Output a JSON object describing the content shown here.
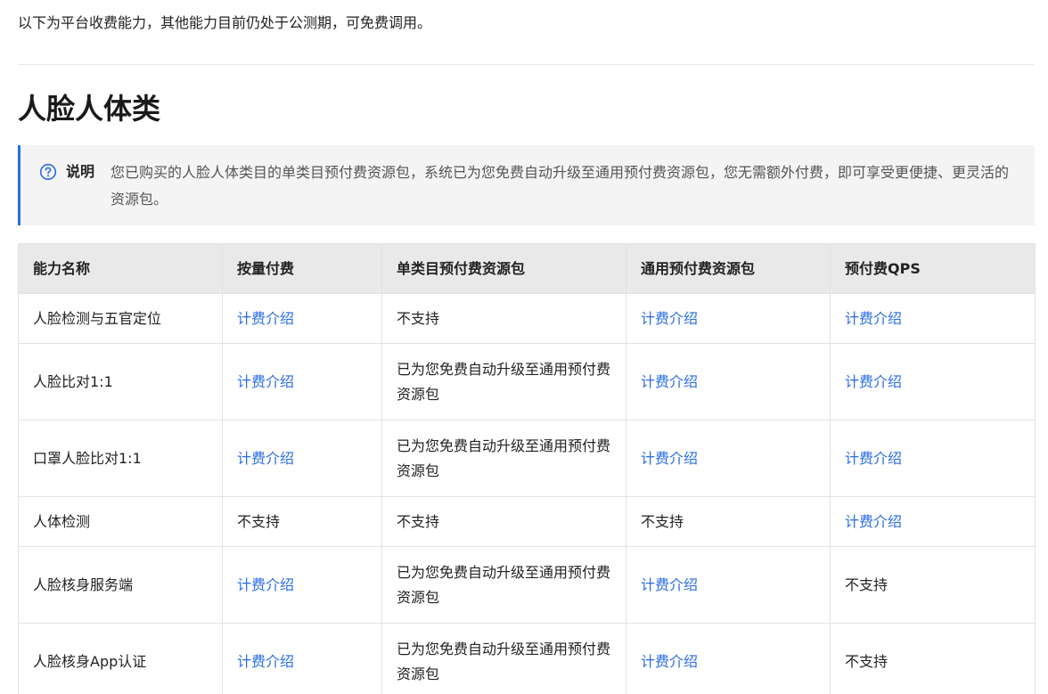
{
  "intro_text": "以下为平台收费能力，其他能力目前仍处于公测期，可免费调用。",
  "section_title": "人脸人体类",
  "note": {
    "icon": "question-circle-icon",
    "label": "说明",
    "text": "您已购买的人脸人体类目的单类目预付费资源包，系统已为您免费自动升级至通用预付费资源包，您无需额外付费，即可享受更便捷、更灵活的资源包。"
  },
  "colors": {
    "accent": "#2a6ce6",
    "header_bg": "#e9e9e9",
    "note_bg": "#f4f4f4"
  },
  "table": {
    "headers": [
      "能力名称",
      "按量付费",
      "单类目预付费资源包",
      "通用预付费资源包",
      "预付费QPS"
    ],
    "rows": [
      {
        "name": "人脸检测与五官定位",
        "pay_as_you_go": "计费介绍",
        "single_category": "不支持",
        "general": "计费介绍",
        "qps": "计费介绍"
      },
      {
        "name": "人脸比对1:1",
        "pay_as_you_go": "计费介绍",
        "single_category": "已为您免费自动升级至通用预付费资源包",
        "general": "计费介绍",
        "qps": "计费介绍"
      },
      {
        "name": "口罩人脸比对1:1",
        "pay_as_you_go": "计费介绍",
        "single_category": "已为您免费自动升级至通用预付费资源包",
        "general": "计费介绍",
        "qps": "计费介绍"
      },
      {
        "name": "人体检测",
        "pay_as_you_go": "不支持",
        "single_category": "不支持",
        "general": "不支持",
        "qps": "计费介绍"
      },
      {
        "name": "人脸核身服务端",
        "pay_as_you_go": "计费介绍",
        "single_category": "已为您免费自动升级至通用预付费资源包",
        "general": "计费介绍",
        "qps": "不支持"
      },
      {
        "name": "人脸核身App认证",
        "pay_as_you_go": "计费介绍",
        "single_category": "已为您免费自动升级至通用预付费资源包",
        "general": "计费介绍",
        "qps": "不支持"
      }
    ]
  }
}
